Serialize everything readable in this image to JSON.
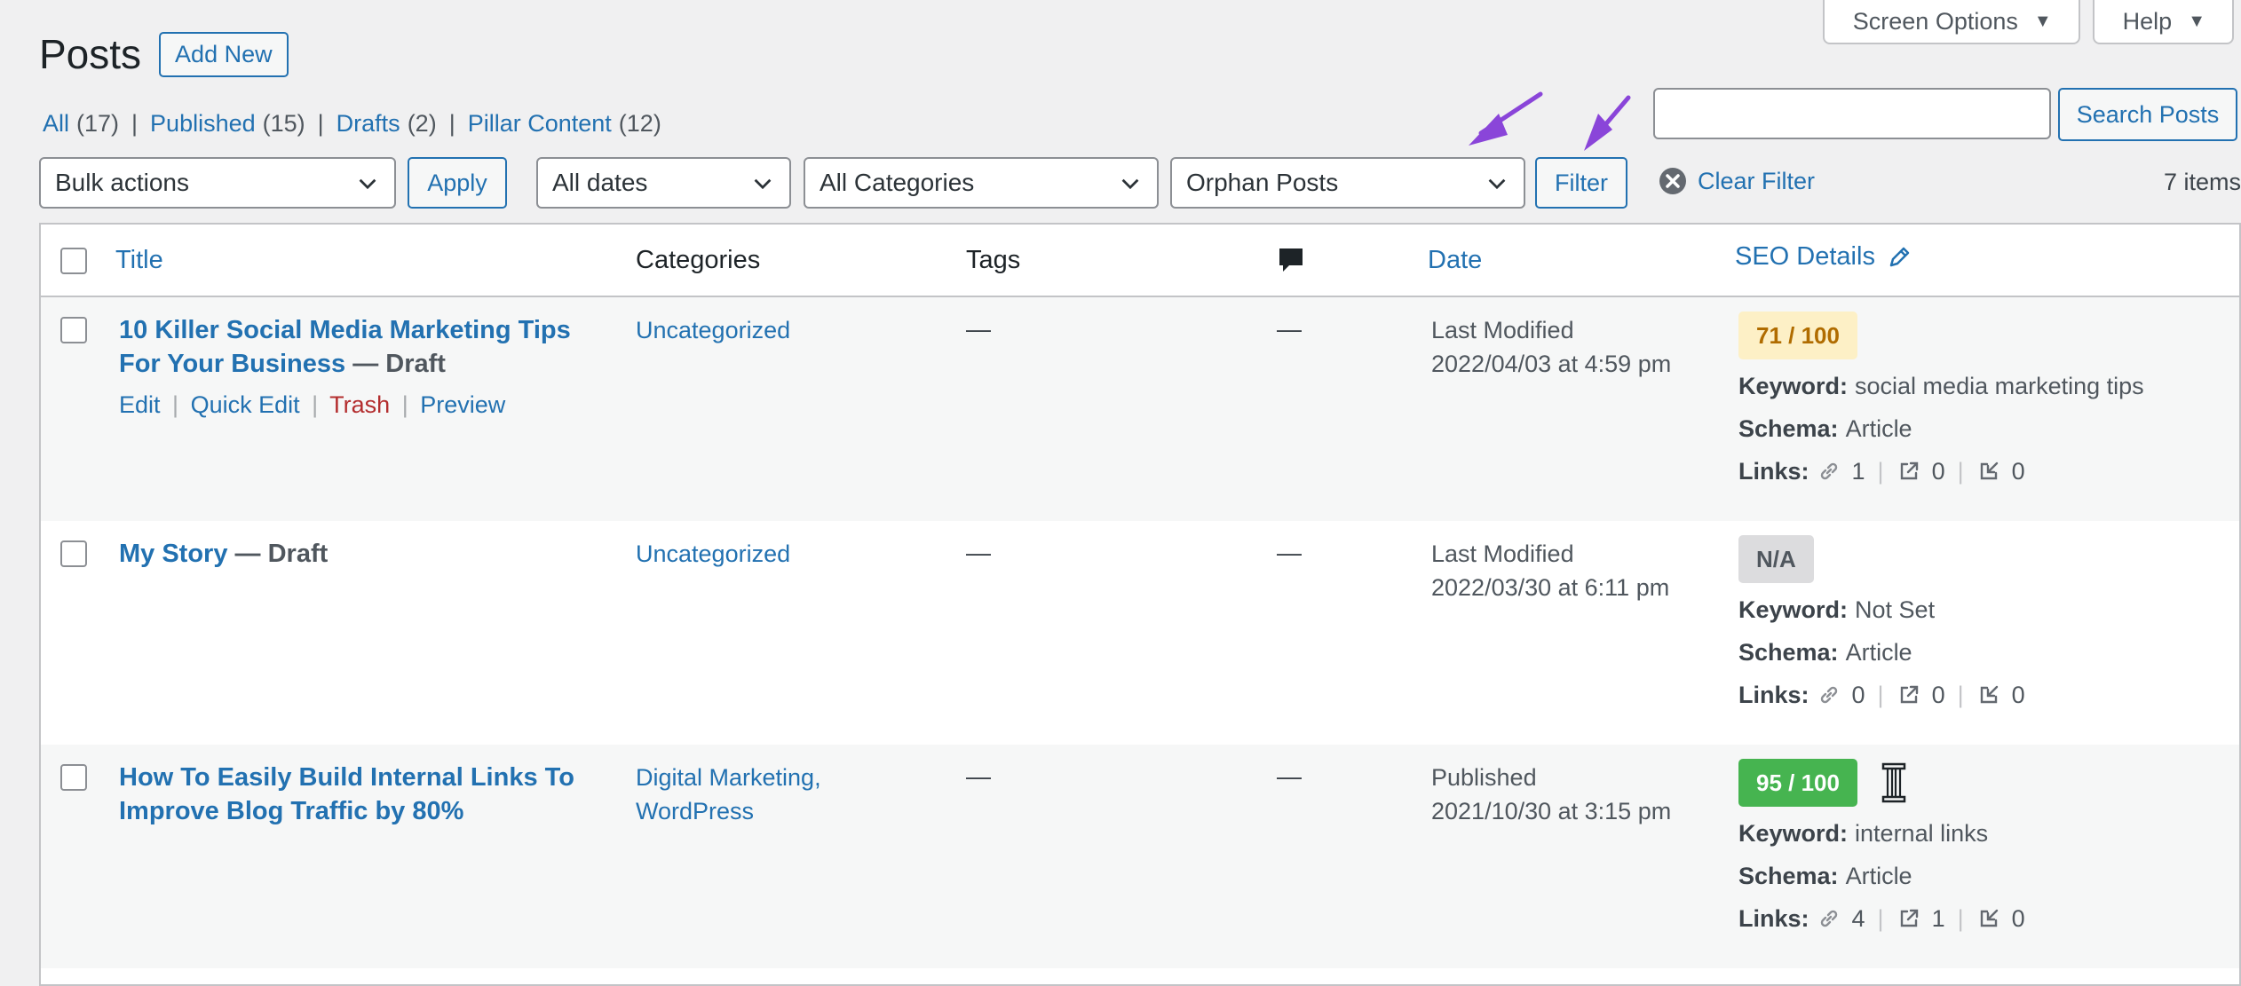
{
  "screen_meta": {
    "screen_options": "Screen Options",
    "help": "Help"
  },
  "header": {
    "title": "Posts",
    "add_new": "Add New"
  },
  "views": [
    {
      "label": "All",
      "count": "(17)"
    },
    {
      "label": "Published",
      "count": "(15)"
    },
    {
      "label": "Drafts",
      "count": "(2)"
    },
    {
      "label": "Pillar Content",
      "count": "(12)"
    }
  ],
  "views_separator": "|",
  "search": {
    "value": "",
    "button": "Search Posts"
  },
  "tablenav": {
    "bulk_actions": "Bulk actions",
    "apply": "Apply",
    "dates": "All dates",
    "categories": "All Categories",
    "seo_filter": "Orphan Posts",
    "filter": "Filter",
    "clear_filter": "Clear Filter",
    "items_count": "7 items"
  },
  "columns": {
    "title": "Title",
    "categories": "Categories",
    "tags": "Tags",
    "date": "Date",
    "seo_details": "SEO Details"
  },
  "labels": {
    "keyword": "Keyword:",
    "schema": "Schema:",
    "links": "Links:",
    "dash": "—",
    "edit": "Edit",
    "quick_edit": "Quick Edit",
    "trash": "Trash",
    "preview": "Preview",
    "action_sep": "|"
  },
  "rows": [
    {
      "title": "10 Killer Social Media Marketing Tips For Your Business",
      "state": "— Draft",
      "categories": [
        "Uncategorized"
      ],
      "tags": "—",
      "comments": "—",
      "date_status": "Last Modified",
      "date": "2022/04/03 at 4:59 pm",
      "score": "71 / 100",
      "keyword": "social media marketing tips",
      "schema": "Article",
      "links_internal": "1",
      "links_external": "0",
      "links_incoming": "0"
    },
    {
      "title": "My Story",
      "state": "— Draft",
      "categories": [
        "Uncategorized"
      ],
      "tags": "—",
      "comments": "—",
      "date_status": "Last Modified",
      "date": "2022/03/30 at 6:11 pm",
      "score": "N/A",
      "keyword": "Not Set",
      "schema": "Article",
      "links_internal": "0",
      "links_external": "0",
      "links_incoming": "0"
    },
    {
      "title": "How To Easily Build Internal Links To Improve Blog Traffic by 80%",
      "state": "",
      "categories": [
        "Digital Marketing,",
        "WordPress"
      ],
      "tags": "—",
      "comments": "—",
      "date_status": "Published",
      "date": "2021/10/30 at 3:15 pm",
      "score": "95 / 100",
      "keyword": "internal links",
      "schema": "Article",
      "links_internal": "4",
      "links_external": "1",
      "links_incoming": "0"
    }
  ],
  "colors": {
    "score_orange_bg": "#fdf0c6",
    "score_orange_text": "#b06c00",
    "score_na_bg": "#dcdcde",
    "score_green_bg": "#46b450",
    "annotation_arrow": "#8a45d9"
  }
}
